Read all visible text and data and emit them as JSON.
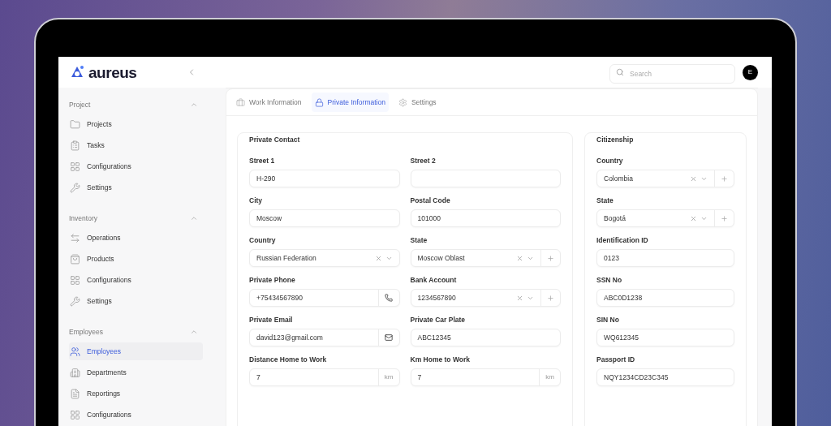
{
  "header": {
    "logo": "aureus",
    "search": {
      "placeholder": "Search"
    },
    "avatar": "E"
  },
  "sidebar": {
    "sections": [
      {
        "title": "Project",
        "expanded": true,
        "items": [
          {
            "label": "Projects",
            "selected": false
          },
          {
            "label": "Tasks",
            "selected": false
          },
          {
            "label": "Configurations",
            "selected": false
          },
          {
            "label": "Settings",
            "selected": false
          }
        ]
      },
      {
        "title": "Inventory",
        "expanded": true,
        "items": [
          {
            "label": "Operations",
            "selected": false
          },
          {
            "label": "Products",
            "selected": false
          },
          {
            "label": "Configurations",
            "selected": false
          },
          {
            "label": "Settings",
            "selected": false
          }
        ]
      },
      {
        "title": "Employees",
        "expanded": true,
        "items": [
          {
            "label": "Employees",
            "selected": true
          },
          {
            "label": "Departments",
            "selected": false
          },
          {
            "label": "Reportings",
            "selected": false
          },
          {
            "label": "Configurations",
            "selected": false
          }
        ]
      }
    ]
  },
  "tabs": [
    {
      "label": "Work Information",
      "selected": false
    },
    {
      "label": "Private Information",
      "selected": true
    },
    {
      "label": "Settings",
      "selected": false
    }
  ],
  "private_contact": {
    "title": "Private Contact",
    "fields": [
      {
        "label": "Street 1",
        "value": "H-290",
        "kind": "text"
      },
      {
        "label": "Street 2",
        "kind": "text"
      },
      {
        "label": "City",
        "value": "Moscow",
        "kind": "text"
      },
      {
        "label": "Postal Code",
        "value": "101000",
        "kind": "text"
      },
      {
        "label": "Country",
        "value": "Russian Federation",
        "kind": "select",
        "add": false
      },
      {
        "label": "State",
        "value": "Moscow Oblast",
        "kind": "select",
        "add": true
      },
      {
        "label": "Private Phone",
        "value": "+75434567890",
        "kind": "phone"
      },
      {
        "label": "Bank Account",
        "value": "1234567890",
        "kind": "select",
        "add": true
      },
      {
        "label": "Private Email",
        "value": "david123@gmail.com",
        "kind": "email"
      },
      {
        "label": "Private Car Plate",
        "value": "ABC12345",
        "kind": "text"
      },
      {
        "label": "Distance Home to Work",
        "value": "7",
        "kind": "unit",
        "unit": "km"
      },
      {
        "label": "Km Home to Work",
        "value": "7",
        "kind": "unit",
        "unit": "km"
      }
    ]
  },
  "citizenship": {
    "title": "Citizenship",
    "fields": [
      {
        "label": "Country",
        "value": "Colombia",
        "kind": "select",
        "add": true
      },
      {
        "label": "State",
        "value": "Bogotá",
        "kind": "select",
        "add": true
      },
      {
        "label": "Identification ID",
        "value": "0123",
        "kind": "text"
      },
      {
        "label": "SSN No",
        "value": "ABC0D1238",
        "kind": "text"
      },
      {
        "label": "SIN No",
        "value": "WQ612345",
        "kind": "text"
      },
      {
        "label": "Passport ID",
        "value": "NQY1234CD23C345",
        "kind": "text"
      }
    ]
  }
}
